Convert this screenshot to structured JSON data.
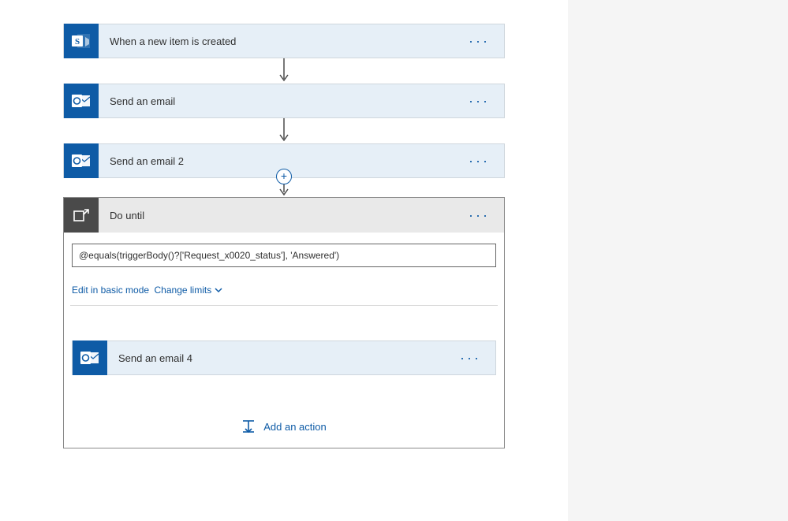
{
  "steps": [
    {
      "title": "When a new item is created",
      "icon": "sharepoint"
    },
    {
      "title": "Send an email",
      "icon": "outlook"
    },
    {
      "title": "Send an email 2",
      "icon": "outlook"
    }
  ],
  "doUntil": {
    "title": "Do until",
    "expression": "@equals(triggerBody()?['Request_x0020_status'], 'Answered')",
    "editBasicLabel": "Edit in basic mode",
    "changeLimitsLabel": "Change limits",
    "innerStep": {
      "title": "Send an email 4",
      "icon": "outlook"
    },
    "addActionLabel": "Add an action"
  }
}
